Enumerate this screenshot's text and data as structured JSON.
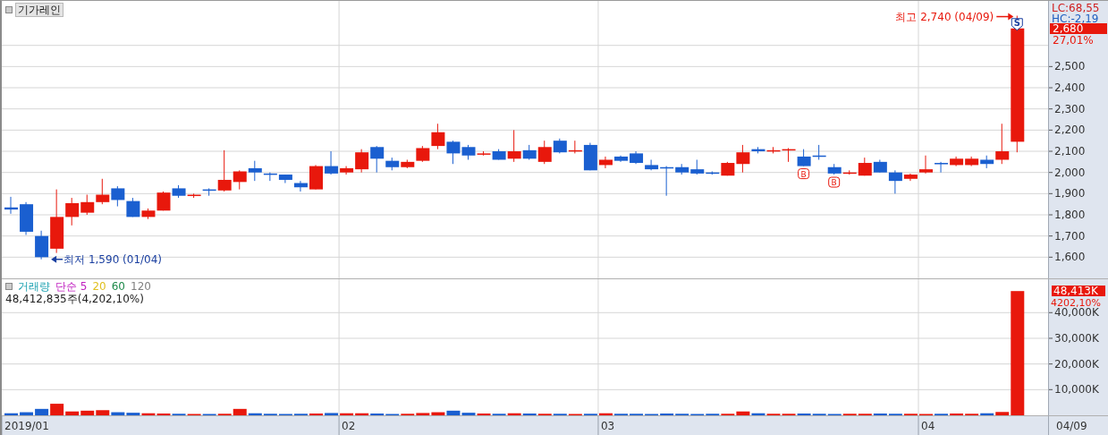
{
  "stock": {
    "name": "기가레인"
  },
  "price_chart": {
    "lc": "LC:68,55",
    "hc": "HC:-2,19",
    "price_badge": "2,680",
    "change": "27,01%",
    "high_label": "최고 2,740 (04/09)",
    "low_label": "최저 1,590 (01/04)",
    "signals": [
      {
        "kind": "none"
      },
      {
        "kind": "none"
      },
      {
        "kind": "none"
      },
      {
        "kind": "none"
      },
      {
        "kind": "none"
      },
      {
        "kind": "none"
      },
      {
        "kind": "none"
      },
      {
        "kind": "none"
      },
      {
        "kind": "none"
      },
      {
        "kind": "none"
      },
      {
        "kind": "none"
      },
      {
        "kind": "none"
      },
      {
        "kind": "none"
      },
      {
        "kind": "none"
      },
      {
        "kind": "none"
      },
      {
        "kind": "none"
      },
      {
        "kind": "none"
      },
      {
        "kind": "none"
      },
      {
        "kind": "none"
      },
      {
        "kind": "none"
      },
      {
        "kind": "none"
      },
      {
        "kind": "none"
      },
      {
        "kind": "none"
      },
      {
        "kind": "none"
      },
      {
        "kind": "none"
      },
      {
        "kind": "none"
      },
      {
        "kind": "none"
      },
      {
        "kind": "none"
      },
      {
        "kind": "none"
      },
      {
        "kind": "none"
      },
      {
        "kind": "none"
      },
      {
        "kind": "none"
      },
      {
        "kind": "none"
      },
      {
        "kind": "none"
      },
      {
        "kind": "none"
      },
      {
        "kind": "none"
      },
      {
        "kind": "none"
      },
      {
        "kind": "none"
      },
      {
        "kind": "none"
      },
      {
        "kind": "none"
      },
      {
        "kind": "none"
      },
      {
        "kind": "none"
      },
      {
        "kind": "none"
      },
      {
        "kind": "none"
      },
      {
        "kind": "none"
      },
      {
        "kind": "none"
      },
      {
        "kind": "none"
      },
      {
        "kind": "none"
      },
      {
        "kind": "none"
      },
      {
        "kind": "none"
      },
      {
        "kind": "none"
      },
      {
        "kind": "none"
      },
      {
        "kind": "buy",
        "text": "B"
      },
      {
        "kind": "none"
      },
      {
        "kind": "buy",
        "text": "B"
      },
      {
        "kind": "none"
      },
      {
        "kind": "none"
      },
      {
        "kind": "none"
      },
      {
        "kind": "none"
      },
      {
        "kind": "none"
      },
      {
        "kind": "none"
      },
      {
        "kind": "none"
      },
      {
        "kind": "none"
      },
      {
        "kind": "none"
      },
      {
        "kind": "none"
      },
      {
        "kind": "none"
      },
      {
        "kind": "sell",
        "text": "S"
      }
    ],
    "chart_data": {
      "type": "candlestick",
      "grid": true,
      "ylim": [
        1500,
        2810
      ],
      "yticks": [
        {
          "value": 1600,
          "label": "1,600"
        },
        {
          "value": 1700,
          "label": "1,700"
        },
        {
          "value": 1800,
          "label": "1,800"
        },
        {
          "value": 1900,
          "label": "1,900"
        },
        {
          "value": 2000,
          "label": "2,000"
        },
        {
          "value": 2100,
          "label": "2,100"
        },
        {
          "value": 2200,
          "label": "2,200"
        },
        {
          "value": 2300,
          "label": "2,300"
        },
        {
          "value": 2400,
          "label": "2,400"
        },
        {
          "value": 2500,
          "label": "2,500"
        }
      ],
      "ohlc": [
        [
          1835,
          1885,
          1805,
          1825
        ],
        [
          1850,
          1860,
          1705,
          1720
        ],
        [
          1700,
          1725,
          1590,
          1600
        ],
        [
          1640,
          1920,
          1620,
          1790
        ],
        [
          1790,
          1880,
          1750,
          1855
        ],
        [
          1810,
          1895,
          1800,
          1860
        ],
        [
          1860,
          1970,
          1850,
          1895
        ],
        [
          1925,
          1935,
          1840,
          1870
        ],
        [
          1865,
          1880,
          1790,
          1790
        ],
        [
          1790,
          1830,
          1780,
          1820
        ],
        [
          1820,
          1910,
          1820,
          1905
        ],
        [
          1925,
          1940,
          1880,
          1890
        ],
        [
          1890,
          1900,
          1880,
          1895
        ],
        [
          1920,
          1925,
          1890,
          1915
        ],
        [
          1915,
          2105,
          1910,
          1965
        ],
        [
          1955,
          2010,
          1920,
          2005
        ],
        [
          2020,
          2055,
          1960,
          2000
        ],
        [
          1995,
          2000,
          1960,
          1990
        ],
        [
          1990,
          1990,
          1950,
          1965
        ],
        [
          1950,
          1960,
          1910,
          1930
        ],
        [
          1920,
          2035,
          1920,
          2030
        ],
        [
          2030,
          2100,
          1990,
          1995
        ],
        [
          2000,
          2030,
          1990,
          2020
        ],
        [
          2015,
          2110,
          2000,
          2095
        ],
        [
          2120,
          2125,
          2000,
          2065
        ],
        [
          2055,
          2070,
          2010,
          2025
        ],
        [
          2025,
          2060,
          2020,
          2050
        ],
        [
          2055,
          2125,
          2050,
          2115
        ],
        [
          2125,
          2230,
          2110,
          2190
        ],
        [
          2145,
          2150,
          2040,
          2090
        ],
        [
          2120,
          2130,
          2060,
          2080
        ],
        [
          2085,
          2100,
          2080,
          2090
        ],
        [
          2100,
          2110,
          2060,
          2060
        ],
        [
          2065,
          2200,
          2050,
          2100
        ],
        [
          2105,
          2130,
          2060,
          2065
        ],
        [
          2050,
          2150,
          2040,
          2120
        ],
        [
          2150,
          2160,
          2090,
          2095
        ],
        [
          2100,
          2150,
          2090,
          2105
        ],
        [
          2130,
          2140,
          2010,
          2010
        ],
        [
          2035,
          2075,
          2020,
          2060
        ],
        [
          2075,
          2080,
          2050,
          2055
        ],
        [
          2090,
          2100,
          2040,
          2045
        ],
        [
          2035,
          2060,
          2010,
          2015
        ],
        [
          2025,
          2030,
          1890,
          2020
        ],
        [
          2025,
          2040,
          1990,
          2000
        ],
        [
          2015,
          2060,
          1990,
          1995
        ],
        [
          2000,
          2005,
          1990,
          1995
        ],
        [
          1985,
          2050,
          1985,
          2045
        ],
        [
          2040,
          2130,
          2000,
          2095
        ],
        [
          2110,
          2120,
          2090,
          2100
        ],
        [
          2100,
          2120,
          2090,
          2105
        ],
        [
          2105,
          2115,
          2050,
          2110
        ],
        [
          2075,
          2110,
          2030,
          2030
        ],
        [
          2080,
          2130,
          2060,
          2075
        ],
        [
          2025,
          2040,
          1990,
          1995
        ],
        [
          2000,
          2010,
          1990,
          2000
        ],
        [
          1985,
          2070,
          1985,
          2045
        ],
        [
          2050,
          2060,
          2000,
          2000
        ],
        [
          2000,
          2010,
          1900,
          1960
        ],
        [
          1970,
          1995,
          1960,
          1990
        ],
        [
          2000,
          2080,
          1995,
          2015
        ],
        [
          2045,
          2050,
          2000,
          2040
        ],
        [
          2035,
          2075,
          2030,
          2065
        ],
        [
          2035,
          2075,
          2030,
          2065
        ],
        [
          2060,
          2080,
          2020,
          2040
        ],
        [
          2060,
          2230,
          2040,
          2100
        ],
        [
          2145,
          2740,
          2095,
          2680
        ]
      ]
    }
  },
  "volume_chart": {
    "title": "거래량",
    "ma_label": "단순 5",
    "ma_periods": [
      {
        "label": "20",
        "color": "#e0c020"
      },
      {
        "label": "60",
        "color": "#1e8a4a"
      },
      {
        "label": "120",
        "color": "#808080"
      }
    ],
    "summary": "48,412,835주(4,202,10%)",
    "badge": "48,413K",
    "change": "4202,10%",
    "chart_data": {
      "type": "bar",
      "grid": true,
      "ylim": [
        0,
        53000
      ],
      "yticks": [
        {
          "value": 10000,
          "label": "10,000K"
        },
        {
          "value": 20000,
          "label": "20,000K"
        },
        {
          "value": 30000,
          "label": "30,000K"
        },
        {
          "value": 40000,
          "label": "40,000K"
        }
      ],
      "values": [
        800,
        1200,
        2500,
        4500,
        1500,
        1800,
        2000,
        1200,
        1000,
        800,
        700,
        600,
        500,
        500,
        600,
        2500,
        800,
        600,
        500,
        600,
        700,
        900,
        800,
        800,
        700,
        500,
        600,
        900,
        1200,
        1800,
        1000,
        700,
        600,
        800,
        700,
        600,
        600,
        500,
        600,
        800,
        600,
        600,
        500,
        700,
        600,
        500,
        600,
        600,
        1500,
        800,
        600,
        600,
        700,
        600,
        500,
        600,
        600,
        700,
        600,
        600,
        500,
        600,
        700,
        600,
        800,
        1300,
        48400
      ]
    }
  },
  "x_axis": {
    "labels": [
      "2019/01",
      "02",
      "03",
      "04"
    ],
    "last_date": "04/09"
  }
}
